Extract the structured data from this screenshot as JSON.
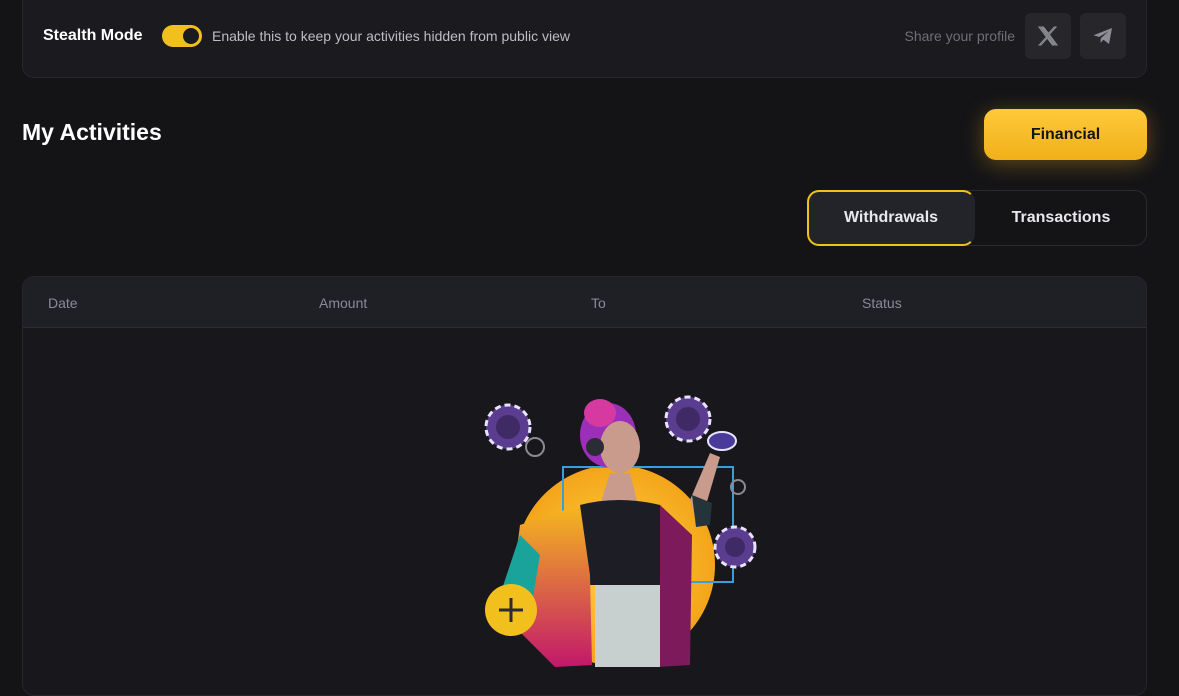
{
  "stealth": {
    "title": "Stealth Mode",
    "enabled": true,
    "description": "Enable this to keep your activities hidden from public view",
    "share_label": "Share your profile",
    "share_icons": [
      "x-icon",
      "telegram-icon"
    ]
  },
  "activities": {
    "title": "My Activities",
    "financial_button": "Financial",
    "tabs": [
      {
        "label": "Withdrawals",
        "active": true
      },
      {
        "label": "Transactions",
        "active": false
      }
    ],
    "table": {
      "columns": [
        "Date",
        "Amount",
        "To",
        "Status"
      ],
      "rows": []
    }
  },
  "colors": {
    "accent": "#f2c01c",
    "background": "#141417",
    "card": "#1b1b1f"
  }
}
